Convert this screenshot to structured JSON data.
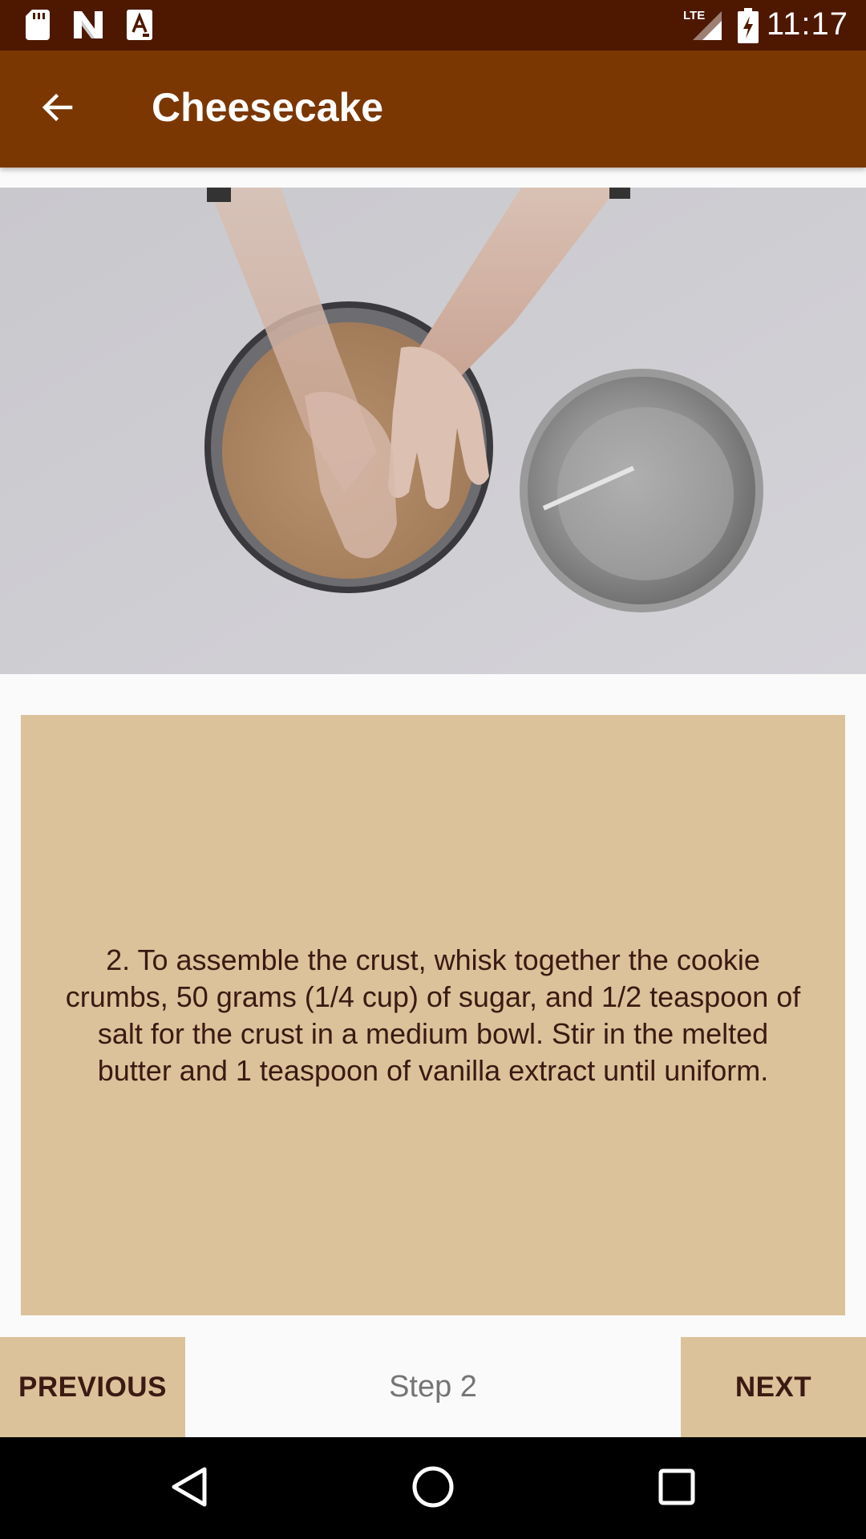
{
  "status_bar": {
    "time": "11:17",
    "network": "LTE",
    "icons": [
      "sd-card-icon",
      "n-logo-icon",
      "a-notification-icon",
      "lte-signal-icon",
      "battery-charging-icon"
    ]
  },
  "app_bar": {
    "title": "Cheesecake",
    "back_icon": "arrow-left-icon"
  },
  "media": {
    "type": "video",
    "description_icon": "video-frame"
  },
  "instruction": {
    "text": "2. To assemble the crust, whisk together the cookie crumbs, 50 grams (1/4 cup) of sugar, and 1/2 teaspoon of salt for the crust in a medium bowl. Stir in the melted butter and 1 teaspoon of vanilla extract until uniform."
  },
  "step_nav": {
    "previous_label": "PREVIOUS",
    "step_label": "Step 2",
    "next_label": "NEXT"
  },
  "nav_bar": {
    "buttons": [
      "back-triangle-icon",
      "home-circle-icon",
      "recents-square-icon"
    ]
  },
  "colors": {
    "status_bar": "#4e1800",
    "app_bar": "#7b3702",
    "card": "#dbc29a",
    "card_text": "#3a1a12",
    "step_text": "#757575",
    "background": "#fafafa"
  }
}
